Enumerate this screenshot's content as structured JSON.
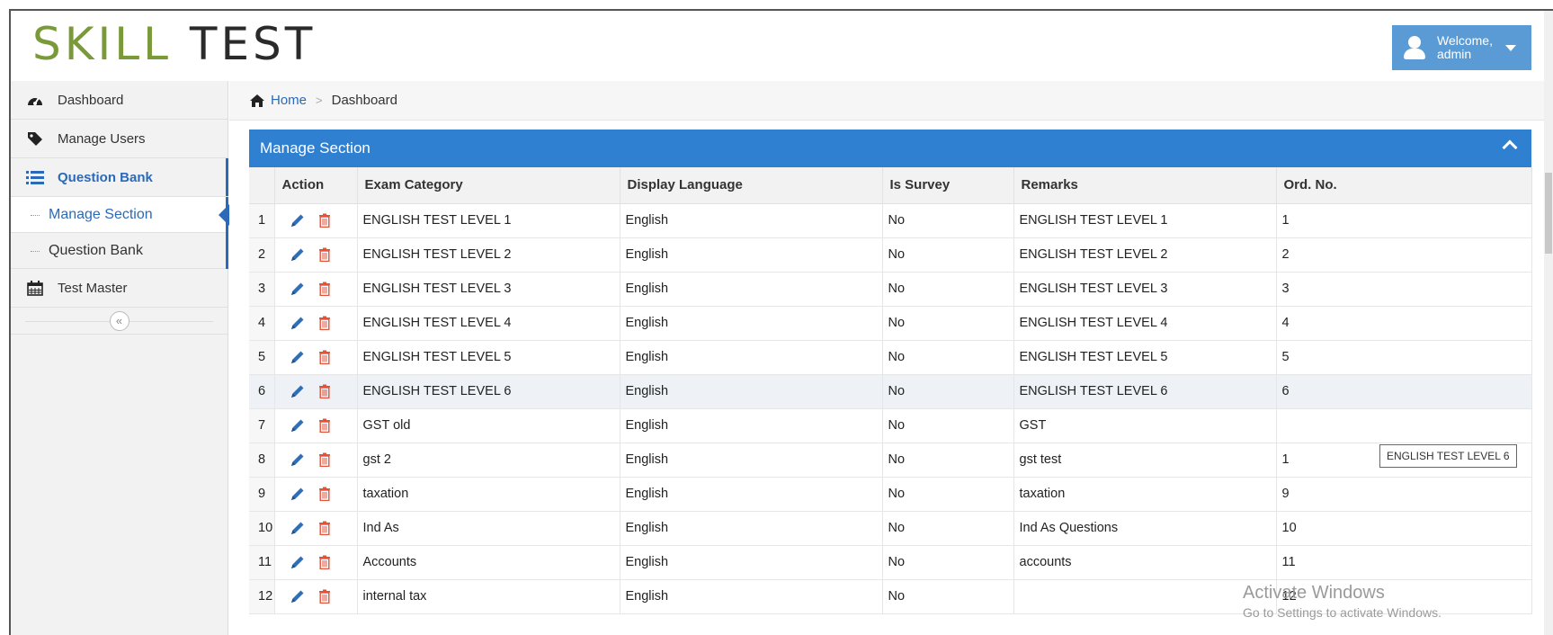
{
  "app": {
    "logo_part1": "SKILL",
    "logo_part2": "TEST",
    "welcome_line1": "Welcome,",
    "welcome_line2": "admin"
  },
  "sidebar": {
    "items": [
      {
        "label": "Dashboard",
        "icon": "dashboard-icon"
      },
      {
        "label": "Manage Users",
        "icon": "tag-icon"
      },
      {
        "label": "Question Bank",
        "icon": "list-icon"
      },
      {
        "label": "Test Master",
        "icon": "calendar-icon"
      }
    ],
    "sub_items": [
      {
        "label": "Manage Section"
      },
      {
        "label": "Question Bank"
      }
    ],
    "collapse_glyph": "«"
  },
  "breadcrumb": {
    "home": "Home",
    "separator": ">",
    "current": "Dashboard"
  },
  "panel": {
    "title": "Manage Section"
  },
  "table": {
    "headers": [
      "",
      "Action",
      "Exam Category",
      "Display Language",
      "Is Survey",
      "Remarks",
      "Ord. No."
    ],
    "rows": [
      {
        "n": "1",
        "category": "ENGLISH TEST LEVEL 1",
        "language": "English",
        "survey": "No",
        "remarks": "ENGLISH TEST LEVEL 1",
        "ord": "1"
      },
      {
        "n": "2",
        "category": "ENGLISH TEST LEVEL 2",
        "language": "English",
        "survey": "No",
        "remarks": "ENGLISH TEST LEVEL 2",
        "ord": "2"
      },
      {
        "n": "3",
        "category": "ENGLISH TEST LEVEL 3",
        "language": "English",
        "survey": "No",
        "remarks": "ENGLISH TEST LEVEL 3",
        "ord": "3"
      },
      {
        "n": "4",
        "category": "ENGLISH TEST LEVEL 4",
        "language": "English",
        "survey": "No",
        "remarks": "ENGLISH TEST LEVEL 4",
        "ord": "4"
      },
      {
        "n": "5",
        "category": "ENGLISH TEST LEVEL 5",
        "language": "English",
        "survey": "No",
        "remarks": "ENGLISH TEST LEVEL 5",
        "ord": "5"
      },
      {
        "n": "6",
        "category": "ENGLISH TEST LEVEL 6",
        "language": "English",
        "survey": "No",
        "remarks": "ENGLISH TEST LEVEL 6",
        "ord": "6"
      },
      {
        "n": "7",
        "category": "GST old",
        "language": "English",
        "survey": "No",
        "remarks": "GST",
        "ord": ""
      },
      {
        "n": "8",
        "category": "gst 2",
        "language": "English",
        "survey": "No",
        "remarks": "gst test",
        "ord": "1"
      },
      {
        "n": "9",
        "category": "taxation",
        "language": "English",
        "survey": "No",
        "remarks": "taxation",
        "ord": "9"
      },
      {
        "n": "10",
        "category": "Ind As",
        "language": "English",
        "survey": "No",
        "remarks": "Ind As Questions",
        "ord": "10"
      },
      {
        "n": "11",
        "category": "Accounts",
        "language": "English",
        "survey": "No",
        "remarks": "accounts",
        "ord": "11"
      },
      {
        "n": "12",
        "category": "internal tax",
        "language": "English",
        "survey": "No",
        "remarks": "",
        "ord": "12"
      }
    ]
  },
  "tooltip": "ENGLISH TEST LEVEL 6",
  "watermark": {
    "line1": "Activate Windows",
    "line2": "Go to Settings to activate Windows."
  },
  "colors": {
    "accent": "#2f80d1",
    "logo_green": "#7a9a3a",
    "delete_red": "#e0533a"
  }
}
